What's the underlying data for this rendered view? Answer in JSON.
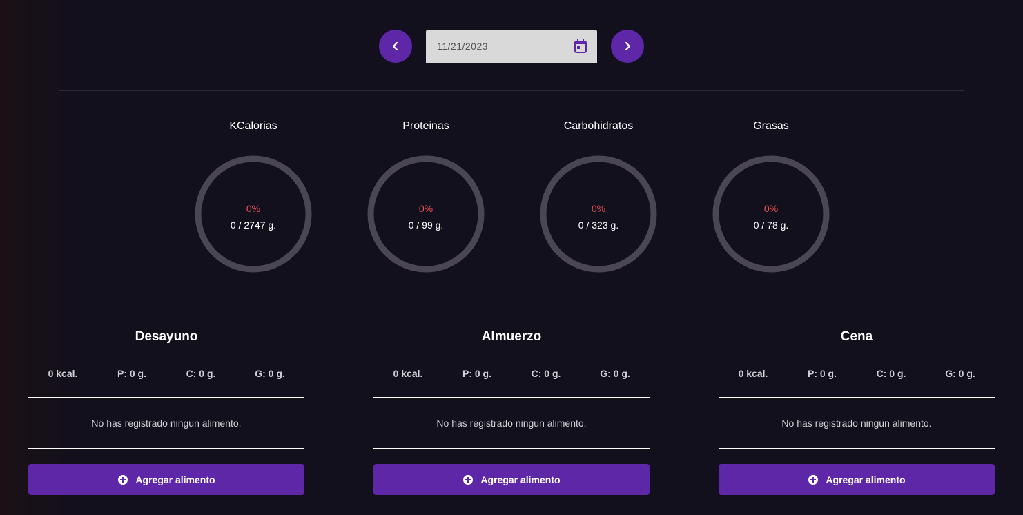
{
  "date_nav": {
    "prev_icon": "chevron-left-icon",
    "next_icon": "chevron-right-icon",
    "date_value": "11/21/2023",
    "calendar_icon": "calendar-icon"
  },
  "macros": [
    {
      "title": "KCalorias",
      "percent": "0%",
      "value": "0 / 2747 g.",
      "progress": 0
    },
    {
      "title": "Proteinas",
      "percent": "0%",
      "value": "0 / 99 g.",
      "progress": 0
    },
    {
      "title": "Carbohidratos",
      "percent": "0%",
      "value": "0 / 323 g.",
      "progress": 0
    },
    {
      "title": "Grasas",
      "percent": "0%",
      "value": "0 / 78 g.",
      "progress": 0
    }
  ],
  "meals": [
    {
      "title": "Desayuno",
      "kcal": "0 kcal.",
      "p": "P: 0 g.",
      "c": "C: 0 g.",
      "g": "G: 0 g.",
      "empty": "No has registrado ningun alimento.",
      "add_label": "Agregar alimento"
    },
    {
      "title": "Almuerzo",
      "kcal": "0 kcal.",
      "p": "P: 0 g.",
      "c": "C: 0 g.",
      "g": "G: 0 g.",
      "empty": "No has registrado ningun alimento.",
      "add_label": "Agregar alimento"
    },
    {
      "title": "Cena",
      "kcal": "0 kcal.",
      "p": "P: 0 g.",
      "c": "C: 0 g.",
      "g": "G: 0 g.",
      "empty": "No has registrado ningun alimento.",
      "add_label": "Agregar alimento"
    }
  ],
  "colors": {
    "accent": "#5e27a8",
    "ring_track": "#4a4753",
    "percent_text": "#ef5350",
    "background": "#12101c"
  }
}
